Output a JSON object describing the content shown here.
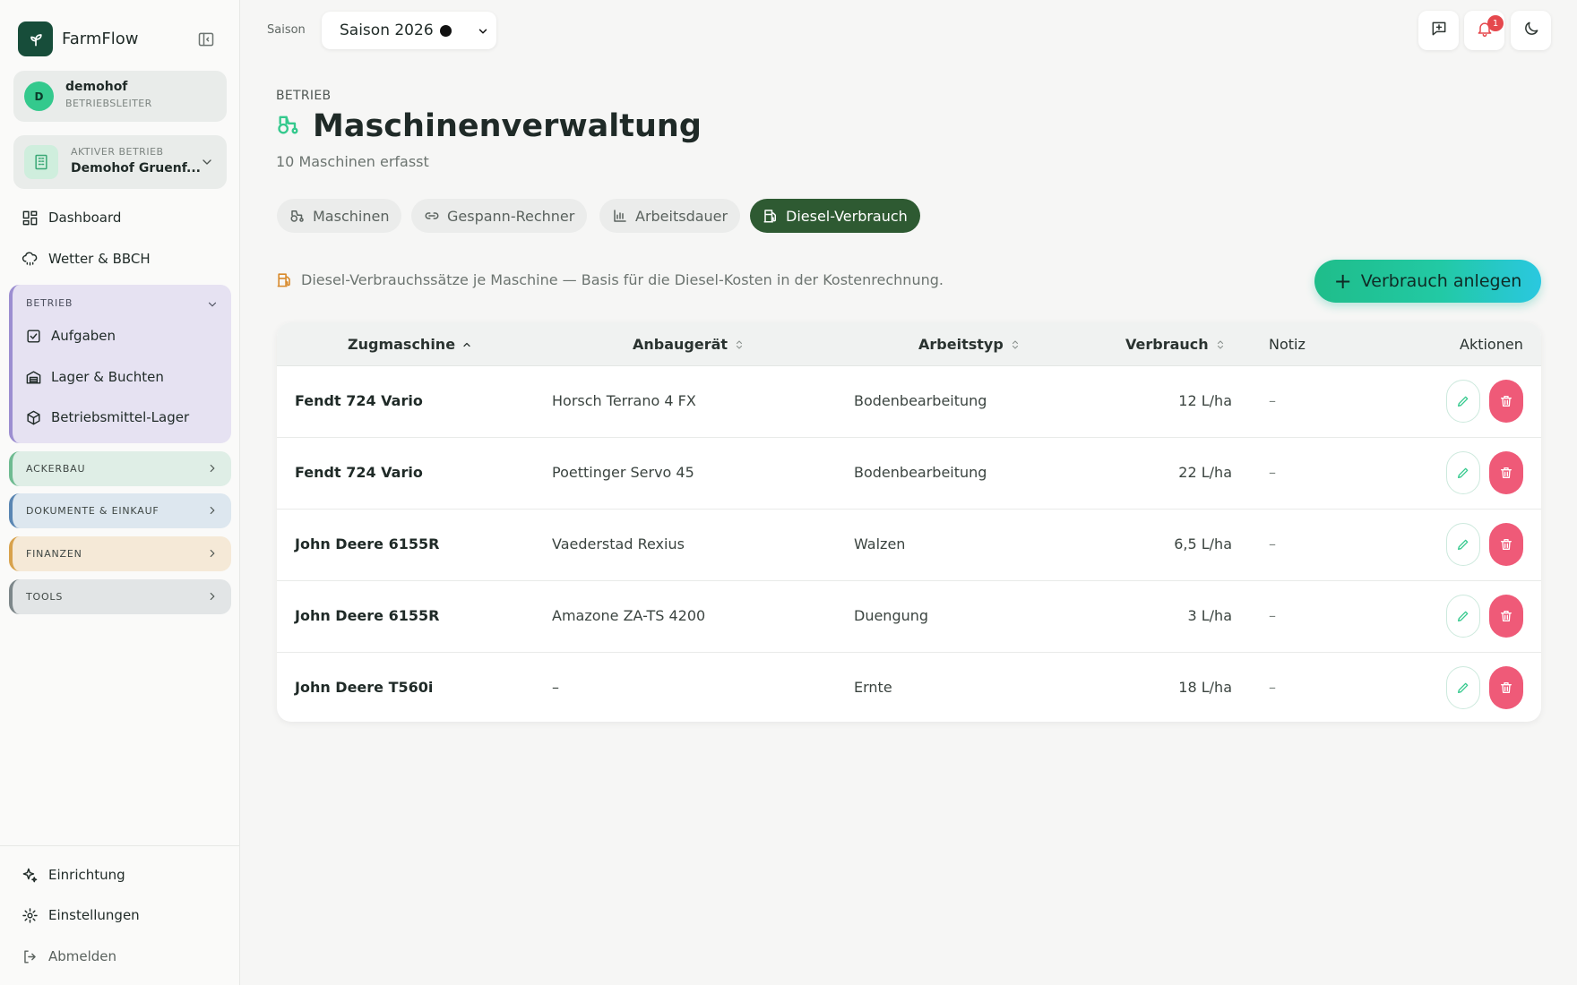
{
  "app": {
    "name": "FarmFlow"
  },
  "user": {
    "initial": "D",
    "name": "demohof",
    "role": "BETRIEBSLEITER"
  },
  "farm": {
    "label": "AKTIVER BETRIEB",
    "name": "Demohof Gruenf..."
  },
  "nav": {
    "dashboard": "Dashboard",
    "weather": "Wetter & BBCH",
    "group_betrieb": {
      "label": "BETRIEB",
      "items": [
        "Aufgaben",
        "Lager & Buchten",
        "Betriebsmittel-Lager"
      ]
    },
    "groups_closed": [
      {
        "label": "ACKERBAU",
        "bg": "#dfeee6",
        "border": "#6fbb91"
      },
      {
        "label": "DOKUMENTE & EINKAUF",
        "bg": "#dde7ef",
        "border": "#5a86b3"
      },
      {
        "label": "FINANZEN",
        "bg": "#f5e9d7",
        "border": "#d8a24c"
      },
      {
        "label": "TOOLS",
        "bg": "#e2e5e6",
        "border": "#7d878a"
      }
    ],
    "setup": "Einrichtung",
    "settings": "Einstellungen",
    "logout": "Abmelden"
  },
  "topbar": {
    "season_label": "Saison",
    "season_value": "Saison 2026",
    "notification_count": "1"
  },
  "page": {
    "breadcrumb": "BETRIEB",
    "title": "Maschinenverwaltung",
    "subtitle": "10 Maschinen erfasst"
  },
  "tabs": [
    {
      "label": "Maschinen",
      "icon": "tractor-icon",
      "active": false
    },
    {
      "label": "Gespann-Rechner",
      "icon": "link-icon",
      "active": false
    },
    {
      "label": "Arbeitsdauer",
      "icon": "bar-chart-icon",
      "active": false
    },
    {
      "label": "Diesel-Verbrauch",
      "icon": "fuel-icon",
      "active": true
    }
  ],
  "info_text": "Diesel-Verbrauchssätze je Maschine — Basis für die Diesel-Kosten in der Kostenrechnung.",
  "add_button": "Verbrauch anlegen",
  "table": {
    "headers": {
      "tractor": "Zugmaschine",
      "implement": "Anbaugerät",
      "work_type": "Arbeitstyp",
      "consumption": "Verbrauch",
      "note": "Notiz",
      "actions": "Aktionen"
    },
    "rows": [
      {
        "tractor": "Fendt 724 Vario",
        "implement": "Horsch Terrano 4 FX",
        "work_type": "Bodenbearbeitung",
        "consumption": "12 L/ha",
        "note": "–"
      },
      {
        "tractor": "Fendt 724 Vario",
        "implement": "Poettinger Servo 45",
        "work_type": "Bodenbearbeitung",
        "consumption": "22 L/ha",
        "note": "–"
      },
      {
        "tractor": "John Deere 6155R",
        "implement": "Vaederstad Rexius",
        "work_type": "Walzen",
        "consumption": "6,5 L/ha",
        "note": "–"
      },
      {
        "tractor": "John Deere 6155R",
        "implement": "Amazone ZA-TS 4200",
        "work_type": "Duengung",
        "consumption": "3 L/ha",
        "note": "–"
      },
      {
        "tractor": "John Deere T560i",
        "implement": "–",
        "work_type": "Ernte",
        "consumption": "18 L/ha",
        "note": "–"
      }
    ]
  },
  "colors": {
    "accent": "#34c98d",
    "tab_active": "#2e5a32",
    "delete": "#ef5a78",
    "brand": "#174d3a"
  }
}
